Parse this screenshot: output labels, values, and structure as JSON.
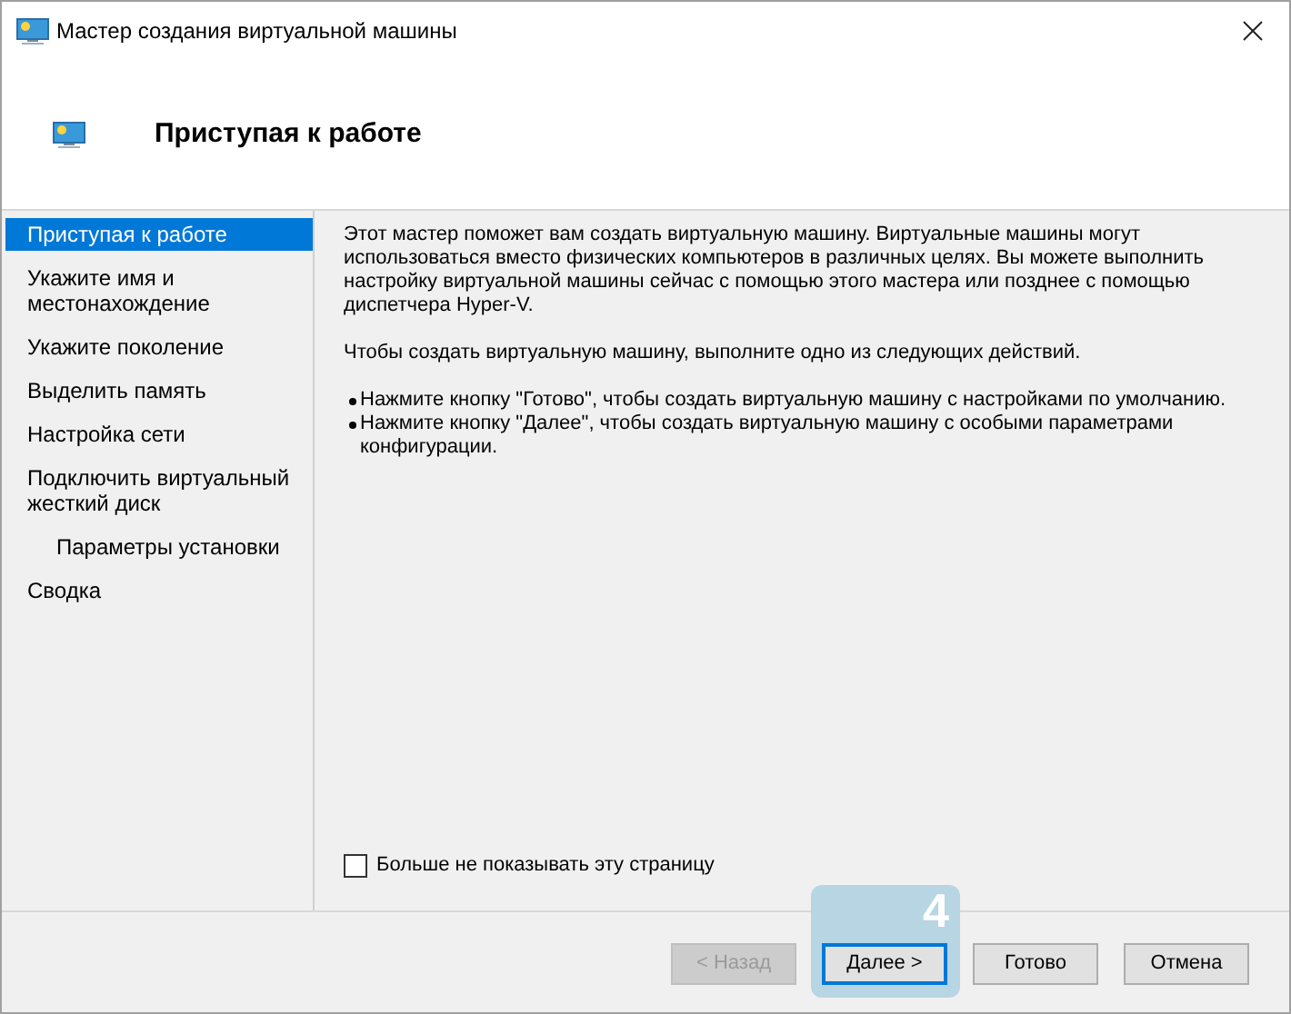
{
  "window": {
    "title": "Мастер создания виртуальной машины"
  },
  "header": {
    "title": "Приступая к работе"
  },
  "sidebar": {
    "items": [
      {
        "label": "Приступая к работе",
        "selected": true
      },
      {
        "label": "Укажите имя и местонахождение",
        "selected": false
      },
      {
        "label": "Укажите поколение",
        "selected": false
      },
      {
        "label": "Выделить память",
        "selected": false
      },
      {
        "label": "Настройка сети",
        "selected": false
      },
      {
        "label": "Подключить виртуальный жесткий диск",
        "selected": false,
        "children": [
          {
            "label": "Параметры установки",
            "selected": false
          }
        ]
      },
      {
        "label": "Сводка",
        "selected": false
      }
    ]
  },
  "content": {
    "paragraphs": [
      "Этот мастер поможет вам создать виртуальную машину. Виртуальные машины могут использоваться вместо физических компьютеров в различных целях. Вы можете выполнить настройку виртуальной машины сейчас с помощью этого мастера или позднее с помощью диспетчера Hyper-V.",
      "Чтобы создать виртуальную машину, выполните одно из следующих действий."
    ],
    "bullets": [
      "Нажмите кнопку \"Готово\", чтобы создать виртуальную машину с настройками по умолчанию.",
      "Нажмите кнопку \"Далее\", чтобы создать виртуальную машину с особыми параметрами конфигурации."
    ]
  },
  "dont_show_checkbox": {
    "label": "Больше не показывать эту страницу",
    "checked": false
  },
  "buttons": [
    {
      "label": "< Назад",
      "disabled": true,
      "focused": false
    },
    {
      "label": "Далее >",
      "disabled": false,
      "focused": true
    },
    {
      "label": "Готово",
      "disabled": false,
      "focused": false
    },
    {
      "label": "Отмена",
      "disabled": false,
      "focused": false
    }
  ],
  "step_badge": "4"
}
